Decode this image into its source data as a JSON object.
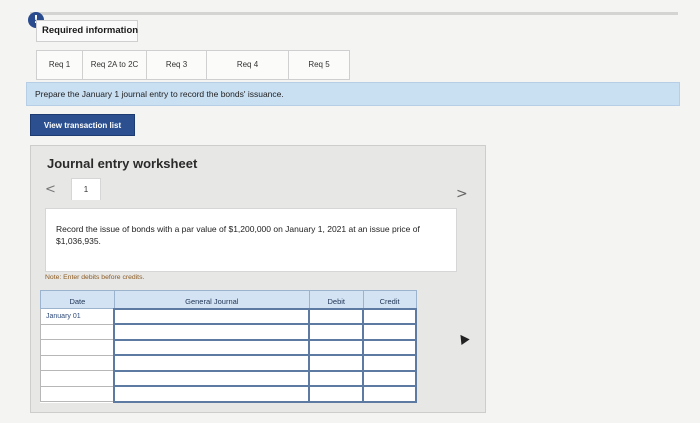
{
  "header": {
    "info_icon": "!",
    "required_information": "Required information"
  },
  "tabs": [
    {
      "label": "Req 1"
    },
    {
      "label": "Req 2A to 2C"
    },
    {
      "label": "Req 3"
    },
    {
      "label": "Req 4"
    },
    {
      "label": "Req 5"
    }
  ],
  "prompt": "Prepare the January 1 journal entry to record the bonds' issuance.",
  "view_transaction_button": "View transaction list",
  "worksheet": {
    "title": "Journal entry worksheet",
    "prev_icon": "<",
    "next_icon": ">",
    "page": "1",
    "description": "Record the issue of bonds with a par value of $1,200,000 on January 1, 2021 at an issue price of $1,036,935.",
    "note": "Note: Enter debits before credits."
  },
  "journal_table": {
    "headers": [
      "Date",
      "General Journal",
      "Debit",
      "Credit"
    ],
    "rows": [
      [
        "January 01",
        "",
        "",
        ""
      ],
      [
        "",
        "",
        "",
        ""
      ],
      [
        "",
        "",
        "",
        ""
      ],
      [
        "",
        "",
        "",
        ""
      ],
      [
        "",
        "",
        "",
        ""
      ],
      [
        "",
        "",
        "",
        ""
      ]
    ]
  },
  "colors": {
    "accent": "#2b4f8f",
    "prompt_bg": "#c9dff2",
    "table_header_bg": "#d3e3f3"
  }
}
